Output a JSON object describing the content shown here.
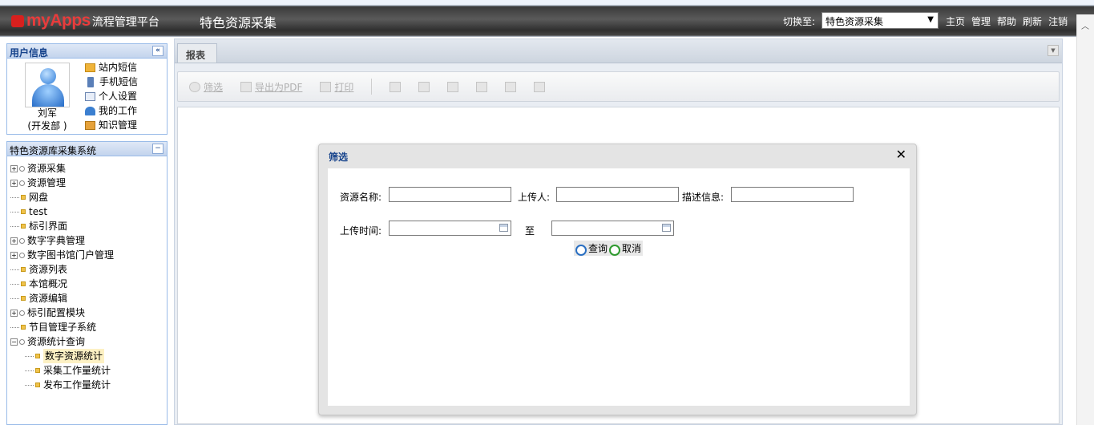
{
  "header": {
    "logo_text": "myApps",
    "logo_sub": "流程管理平台",
    "app_title": "特色资源采集",
    "switch_label": "切换至:",
    "switch_value": "特色资源采集",
    "nav": [
      "主页",
      "管理",
      "帮助",
      "刷新",
      "注销"
    ]
  },
  "user_panel": {
    "title": "用户信息",
    "name": "刘军",
    "dept": "(开发部 )",
    "links": [
      "站内短信",
      "手机短信",
      "个人设置",
      "我的工作",
      "知识管理"
    ]
  },
  "tree_panel": {
    "title": "特色资源库采集系统",
    "items": [
      {
        "label": "资源采集",
        "kind": "folder"
      },
      {
        "label": "资源管理",
        "kind": "folder"
      },
      {
        "label": "网盘",
        "kind": "leaf"
      },
      {
        "label": "test",
        "kind": "leaf"
      },
      {
        "label": "标引界面",
        "kind": "leaf"
      },
      {
        "label": "数字字典管理",
        "kind": "folder"
      },
      {
        "label": "数字图书馆门户管理",
        "kind": "folder"
      },
      {
        "label": "资源列表",
        "kind": "leaf"
      },
      {
        "label": "本馆概况",
        "kind": "leaf"
      },
      {
        "label": "资源编辑",
        "kind": "leaf"
      },
      {
        "label": "标引配置模块",
        "kind": "folder"
      },
      {
        "label": "节目管理子系统",
        "kind": "leaf"
      },
      {
        "label": "资源统计查询",
        "kind": "folder-open"
      },
      {
        "label": "数字资源统计",
        "kind": "child-selected"
      },
      {
        "label": "采集工作量统计",
        "kind": "child"
      },
      {
        "label": "发布工作量统计",
        "kind": "child"
      }
    ]
  },
  "main": {
    "tab_label": "报表",
    "toolbar": [
      "筛选",
      "导出为PDF",
      "打印"
    ]
  },
  "dialog": {
    "title": "筛选",
    "close": "✕",
    "labels": {
      "resource_name": "资源名称:",
      "uploader": "上传人:",
      "description": "描述信息:",
      "upload_time": "上传时间:",
      "to": "至"
    },
    "values": {
      "resource_name": "",
      "uploader": "",
      "description": "",
      "time_from": "",
      "time_to": ""
    },
    "buttons": {
      "query": "查询",
      "cancel": "取消"
    }
  },
  "colors": {
    "logo_red": "#e83c3c",
    "panel_border": "#99bbe8",
    "panel_title": "#15428b"
  }
}
